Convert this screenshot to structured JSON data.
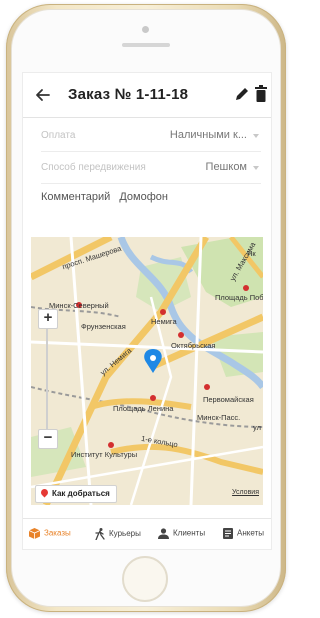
{
  "header": {
    "title": "Заказ № 1-11-18"
  },
  "form": {
    "payment": {
      "label": "Оплата",
      "value": "Наличными к..."
    },
    "delivery": {
      "label": "Способ передвижения",
      "value": "Пешком"
    },
    "tabs": [
      "Комментарий",
      "Домофон"
    ]
  },
  "map": {
    "labels": {
      "prosp_masherova": "просп. Машерова",
      "maksima": "ул. Максима",
      "minsk_severny": "Минск-Северный",
      "nemiga_top": "Немига",
      "frunzenskaya": "Фрунзенская",
      "ul_nemiga": "ул. Немига",
      "oktyabrskaya": "Октябрьская",
      "ploshchad_pobedy": "Площадь Побе",
      "ploshchad_lenina": "Площадь Ленина",
      "pervomaiskaya": "Первомайская",
      "minsk_pass": "Минск-Пасс.",
      "institute": "Институт Культуры",
      "kolco": "1-е кольцо",
      "ul": "ул",
      "yakub": "Як"
    },
    "route_button": "Как добраться",
    "terms": "Условия"
  },
  "nav": {
    "orders": "Заказы",
    "couriers": "Курьеры",
    "clients": "Клиенты",
    "forms": "Анкеты"
  },
  "colors": {
    "accent": "#e8832a",
    "map_pin": "#1e88e5"
  }
}
